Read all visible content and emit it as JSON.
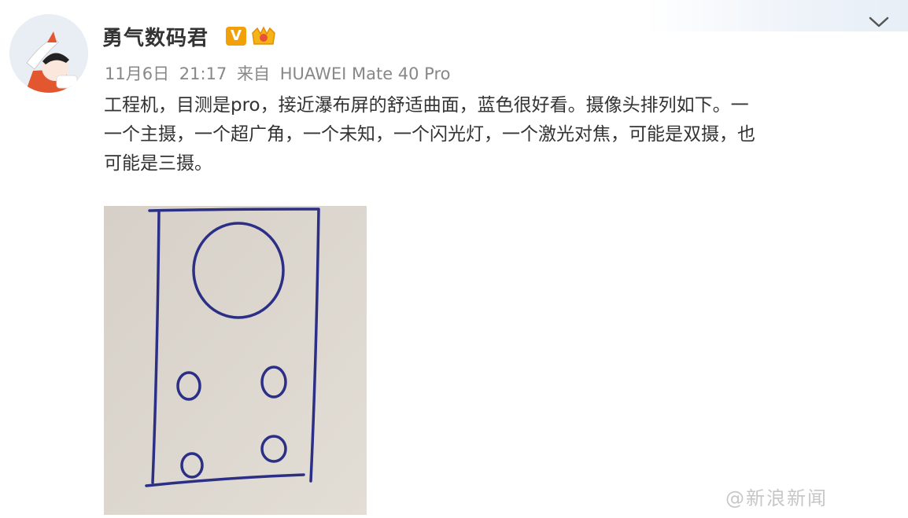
{
  "post": {
    "author": {
      "name": "勇气数码君",
      "verified_badge": "V"
    },
    "meta": {
      "date": "11月6日",
      "time": "21:17",
      "source_prefix": "来自",
      "source_device": "HUAWEI Mate 40 Pro"
    },
    "text": {
      "line1": "工程机，目测是pro，接近瀑布屏的舒适曲面，蓝色很好看。摄像头排列如下。一",
      "line2": "一个主摄，一个超广角，一个未知，一个闪光灯，一个激光对焦，可能是双摄，也",
      "line3": "可能是三摄。"
    }
  },
  "watermark": "@新浪新闻",
  "colors": {
    "ink_blue": "#2b2f86",
    "paper": "#d9d3cb",
    "vip_orange": "#f2a007",
    "meta_gray": "#888888"
  },
  "icons": {
    "verified": "verified-v-icon",
    "level": "crown-level-icon",
    "menu": "chevron-down-icon"
  }
}
